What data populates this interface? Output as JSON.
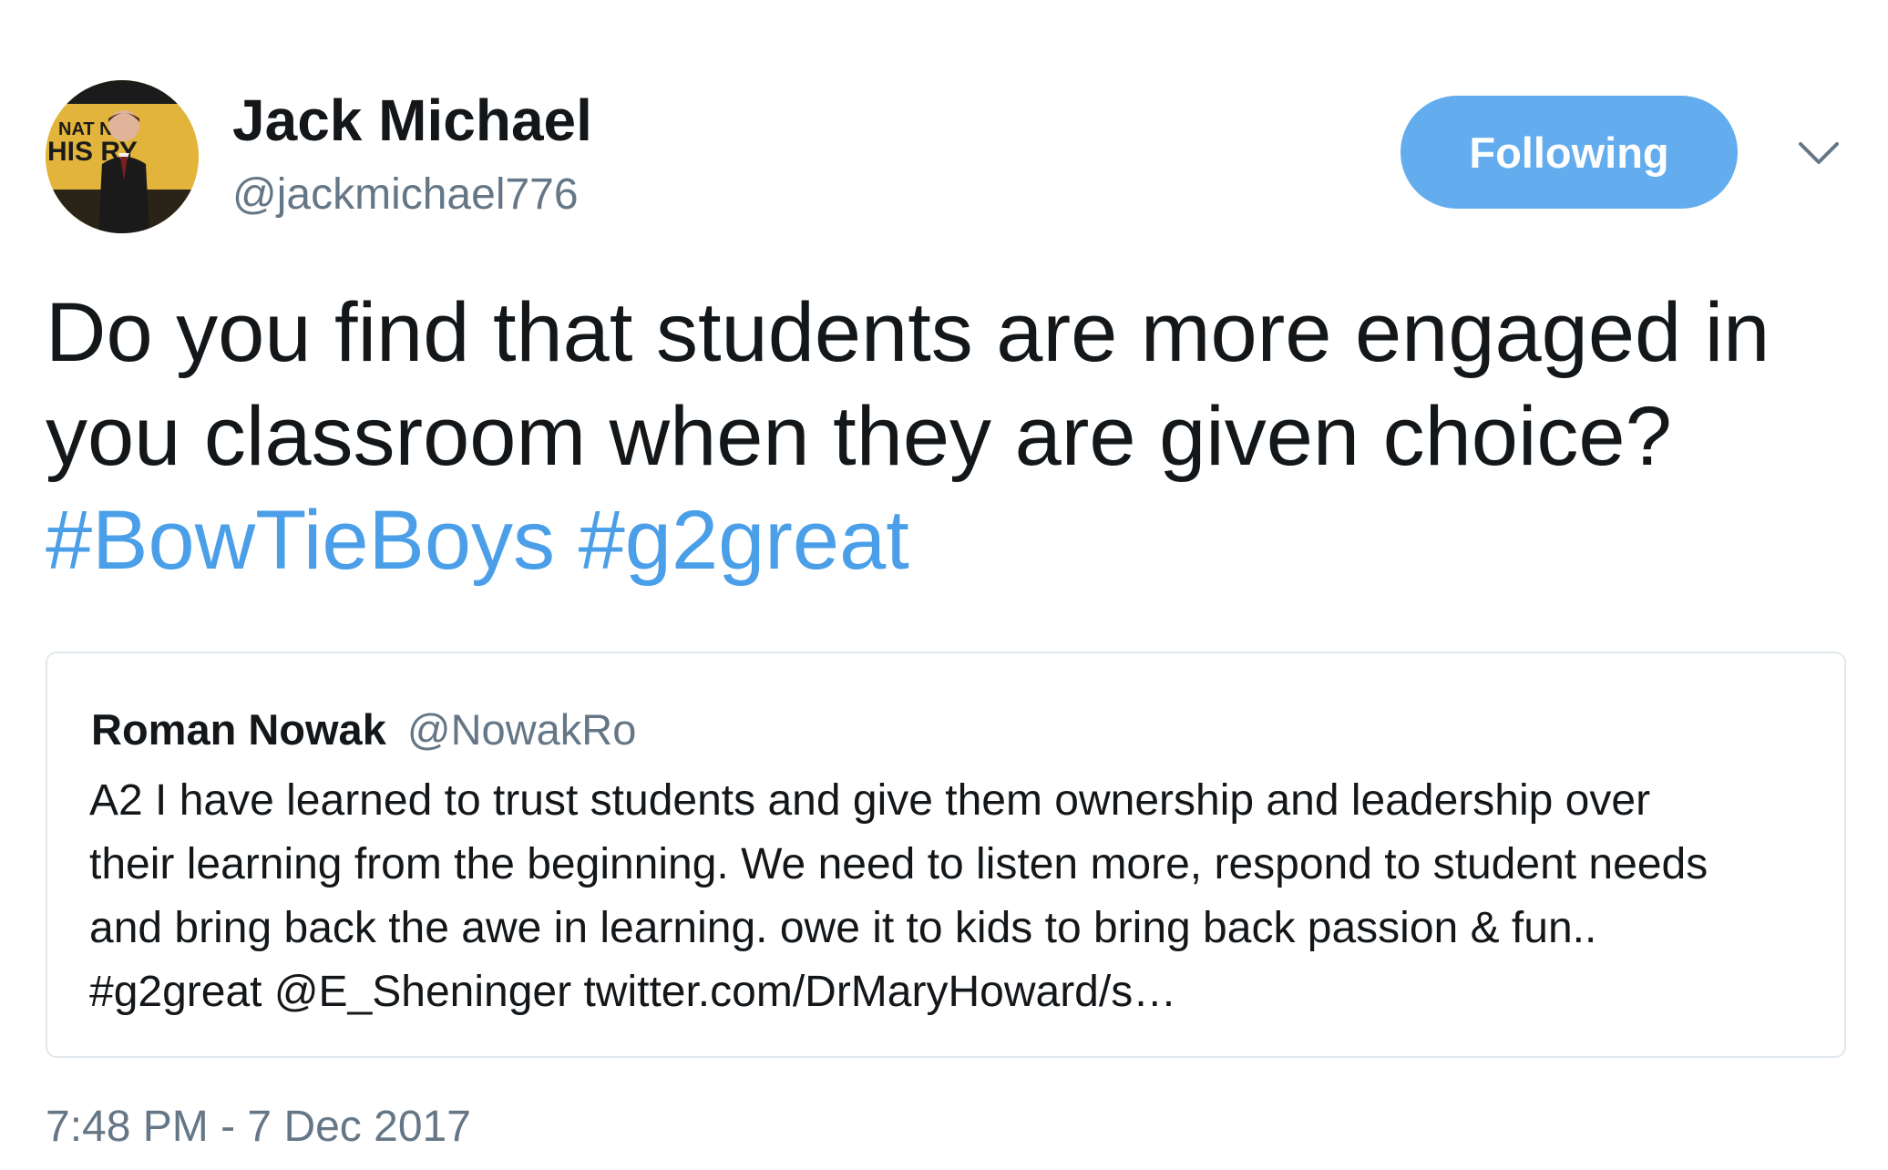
{
  "author": {
    "display_name": "Jack Michael",
    "handle": "@jackmichael776",
    "avatar_sign_line1": "NAT    NAL",
    "avatar_sign_line2": "HIS      RY"
  },
  "follow_button": {
    "label": "Following",
    "color": "#63aced"
  },
  "tweet": {
    "text": "Do you find that students are more engaged in you classroom when they are given choice?",
    "hashtags": [
      "#BowTieBoys",
      "#g2great"
    ],
    "hashtag_color": "#4a9fe8"
  },
  "quoted_tweet": {
    "name": "Roman Nowak",
    "handle": "@NowakRo",
    "lines": [
      "A2 I have learned to trust students and give them ownership and leadership over",
      "their learning from the beginning. We need to listen more, respond to student needs",
      "and bring back the awe in learning. owe it to kids to bring back passion & fun..",
      "#g2great @E_Sheninger twitter.com/DrMaryHoward/s…"
    ]
  },
  "timestamp": "7:48 PM - 7 Dec 2017",
  "icons": {
    "more_menu": "chevron-down-icon"
  }
}
